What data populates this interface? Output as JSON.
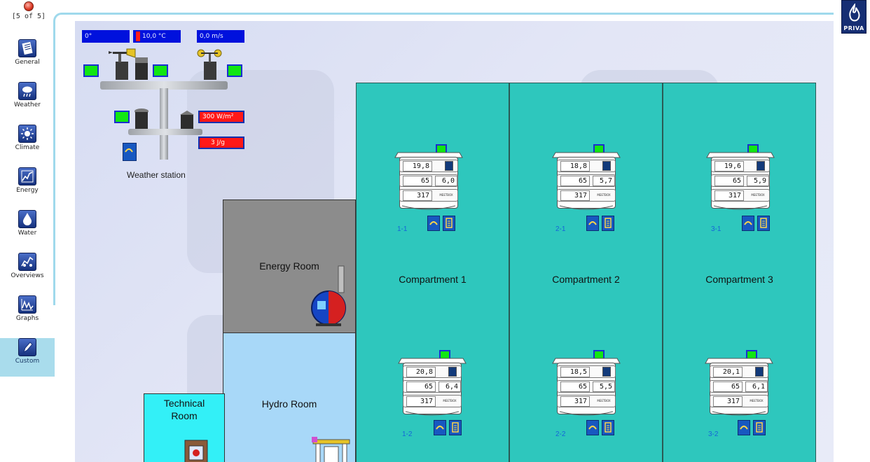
{
  "pager": {
    "text": "[5 of 5]"
  },
  "sidebar": {
    "items": [
      {
        "label": "General",
        "icon": "general-icon"
      },
      {
        "label": "Weather",
        "icon": "weather-icon"
      },
      {
        "label": "Climate",
        "icon": "climate-icon"
      },
      {
        "label": "Energy",
        "icon": "energy-icon"
      },
      {
        "label": "Water",
        "icon": "water-icon"
      },
      {
        "label": "Overviews",
        "icon": "overviews-icon"
      },
      {
        "label": "Graphs",
        "icon": "graphs-icon"
      },
      {
        "label": "Custom",
        "icon": "custom-icon",
        "active": true
      }
    ]
  },
  "weather_station": {
    "caption": "Weather station",
    "wind_direction": "0°",
    "temperature": "10,0 °C",
    "wind_speed": "0,0 m/s",
    "radiation": "300 W/m²",
    "radiation_sum": "3 J/g"
  },
  "rooms": {
    "energy": "Energy Room",
    "hydro": "Hydro Room",
    "technical": "Technical Room"
  },
  "compartments": [
    {
      "label": "Compartment 1"
    },
    {
      "label": "Compartment 2"
    },
    {
      "label": "Compartment 3"
    }
  ],
  "units": [
    {
      "id": "1-1",
      "temp": "19,8",
      "rh": "65",
      "def": "6,0",
      "co2": "317"
    },
    {
      "id": "2-1",
      "temp": "18,8",
      "rh": "65",
      "def": "5,7",
      "co2": "317"
    },
    {
      "id": "3-1",
      "temp": "19,6",
      "rh": "65",
      "def": "5,9",
      "co2": "317"
    },
    {
      "id": "1-2",
      "temp": "20,8",
      "rh": "65",
      "def": "6,4",
      "co2": "317"
    },
    {
      "id": "2-2",
      "temp": "18,5",
      "rh": "65",
      "def": "5,5",
      "co2": "317"
    },
    {
      "id": "3-2",
      "temp": "20,1",
      "rh": "65",
      "def": "6,1",
      "co2": "317"
    }
  ],
  "unit_mini_text": "MEETBOX",
  "brand": {
    "name": "PRIVA"
  },
  "colors": {
    "accent": "#9fd9ec",
    "compartment": "#2ec7bd",
    "energy_room": "#8c8c8c",
    "hydro_room": "#a8d8f8",
    "technical_room": "#33f0f7",
    "indicator_green": "#12e612",
    "readout_blue": "#0011dd"
  }
}
